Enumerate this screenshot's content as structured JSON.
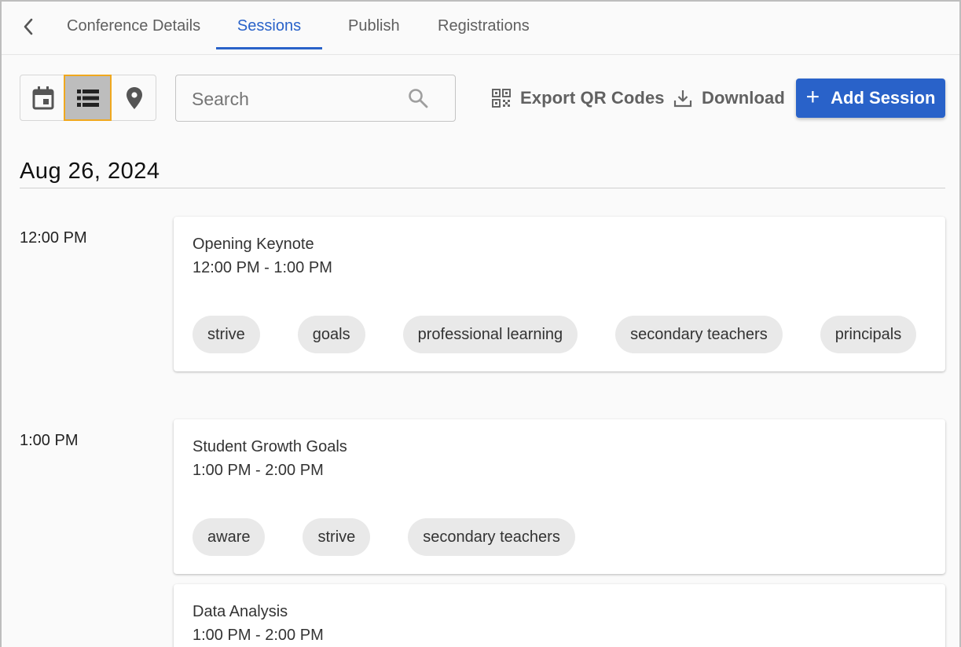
{
  "nav": {
    "back_icon": "chevron-left-icon",
    "tabs": [
      {
        "label": "Conference Details"
      },
      {
        "label": "Sessions"
      },
      {
        "label": "Publish"
      },
      {
        "label": "Registrations"
      }
    ],
    "active_tab": "Sessions"
  },
  "toolbar": {
    "views": [
      {
        "name": "calendar-view",
        "icon": "calendar-icon"
      },
      {
        "name": "list-view",
        "icon": "list-icon",
        "selected": true
      },
      {
        "name": "map-view",
        "icon": "location-pin-icon"
      }
    ],
    "search": {
      "placeholder": "Search",
      "value": ""
    },
    "export_label": "Export QR Codes",
    "download_label": "Download",
    "add_label": "Add Session"
  },
  "schedule": {
    "date": "Aug 26, 2024",
    "slots": [
      {
        "time": "12:00 PM",
        "sessions": [
          {
            "title": "Opening Keynote",
            "time_range": "12:00 PM - 1:00 PM",
            "tags": [
              "strive",
              "goals",
              "professional learning",
              "secondary teachers",
              "principals"
            ]
          }
        ]
      },
      {
        "time": "1:00 PM",
        "sessions": [
          {
            "title": "Student Growth Goals",
            "time_range": "1:00 PM - 2:00 PM",
            "tags": [
              "aware",
              "strive",
              "secondary teachers"
            ]
          },
          {
            "title": "Data Analysis",
            "time_range": "1:00 PM - 2:00 PM",
            "tags": []
          }
        ]
      }
    ]
  },
  "colors": {
    "accent": "#2962c9",
    "selected_outline": "#f0a81e",
    "chip_bg": "#e9e9e9"
  }
}
